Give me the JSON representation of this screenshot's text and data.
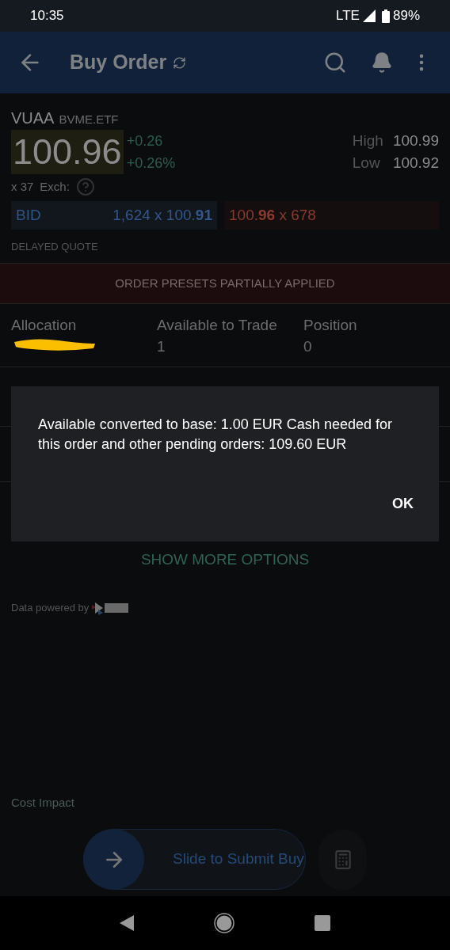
{
  "status_bar": {
    "time": "10:35",
    "network": "LTE",
    "battery": "89%"
  },
  "app_bar": {
    "title": "Buy Order"
  },
  "quote": {
    "symbol": "VUAA",
    "exchange": "BVME.ETF",
    "last": "100.96",
    "change": "+0.26",
    "change_pct": "+0.26%",
    "high_label": "High",
    "high": "100.99",
    "low_label": "Low",
    "low": "100.92",
    "size": "x 37",
    "exch_label": "Exch:",
    "bid_label": "BID",
    "bid": "1,624 x 100.**91**",
    "ask": "100.**96** x 678",
    "delayed": "DELAYED QUOTE"
  },
  "banner": "ORDER PRESETS PARTIALLY APPLIED",
  "account": [
    {
      "label": "Allocation",
      "redacted": true
    },
    {
      "label": "Available to Trade",
      "value": "1",
      "redacted": false
    },
    {
      "label": "Position",
      "value": "0",
      "redacted": false
    }
  ],
  "dialog": {
    "message": "Available converted to base: 1.00 EUR Cash needed for this order and other pending orders: 109.60 EUR",
    "button": "OK"
  },
  "show_more": "SHOW MORE OPTIONS",
  "powered_by": "Data powered by",
  "cost_impact": "Cost Impact",
  "slider": {
    "label": "Slide to Submit Buy",
    "level": 0
  }
}
